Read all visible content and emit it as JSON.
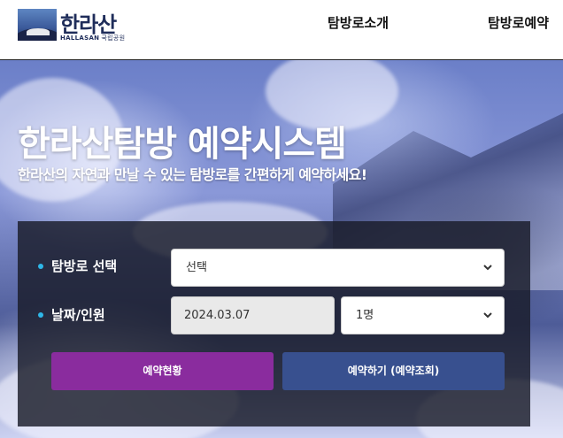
{
  "header": {
    "logo_text": "한라산",
    "logo_sub": "HALLASAN",
    "logo_sub_kr": "국립공원",
    "nav": [
      {
        "label": "탐방로소개"
      },
      {
        "label": "탐방로예약"
      }
    ]
  },
  "hero": {
    "title": "한라산탐방 예약시스템",
    "subtitle": "한라산의 자연과 만날 수 있는 탐방로를 간편하게 예약하세요!"
  },
  "form": {
    "route_label": "탐방로 선택",
    "route_value": "선택",
    "date_label": "날짜/인원",
    "date_value": "2024.03.07",
    "people_value": "1명"
  },
  "buttons": {
    "status_label": "예약현황",
    "reserve_label": "예약하기 (예약조회)"
  },
  "colors": {
    "accent_bullet": "#2eb7e8",
    "status_button": "#8a2c9e",
    "reserve_button": "#38508f",
    "panel_bg": "#191b28"
  }
}
